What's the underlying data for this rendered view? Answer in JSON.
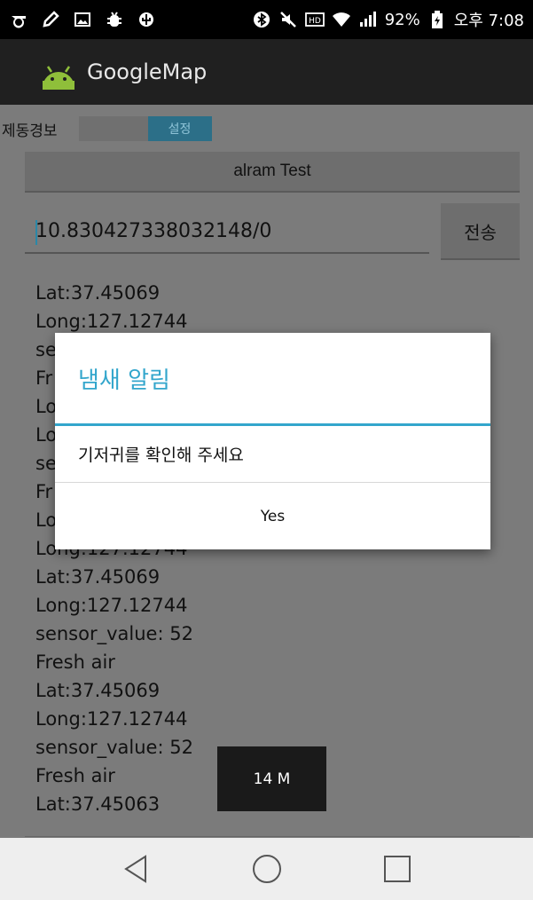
{
  "status_bar": {
    "battery": "92%",
    "time": "오후 7:08",
    "icons": [
      "sigma-icon",
      "pen-icon",
      "image-icon",
      "bug-icon",
      "usb-icon",
      "bluetooth-icon",
      "mute-icon",
      "hd-icon",
      "wifi-icon",
      "signal-icon",
      "battery-icon"
    ]
  },
  "app_bar": {
    "title": "GoogleMap",
    "logo": "android-icon"
  },
  "controls": {
    "label": "제동경보",
    "set_button": "설정",
    "alarm_button": "alram Test",
    "coord_value": "10.830427338032148/0",
    "send_button": "전송"
  },
  "log": [
    "Lat:37.45069",
    "Long:127.12744",
    "se",
    "Fr",
    "Lo",
    "Lo",
    "se",
    "Fr",
    "Lo",
    "Long:127.12744",
    "Lat:37.45069",
    "Long:127.12744",
    "sensor_value: 52",
    "Fresh air",
    "Lat:37.45069",
    "Long:127.12744",
    "sensor_value: 52",
    "Fresh air",
    "Lat:37.45063"
  ],
  "dialog": {
    "title": "냄새 알림",
    "message": "기저귀를 확인해 주세요",
    "button": "Yes",
    "accent": "#33a6cc"
  },
  "toast": {
    "text": "14 M"
  },
  "nav_bar": {
    "icons": [
      "back-icon",
      "home-icon",
      "recents-icon"
    ]
  }
}
